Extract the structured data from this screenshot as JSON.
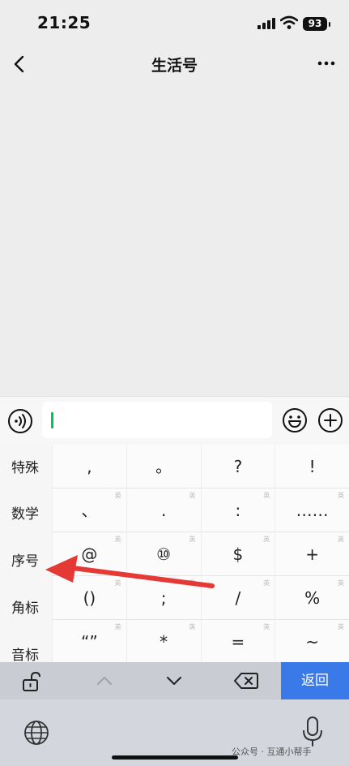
{
  "status_bar": {
    "time": "21:25",
    "battery": "93"
  },
  "nav": {
    "title": "生活号"
  },
  "keyboard": {
    "categories": [
      "特殊",
      "数学",
      "序号",
      "角标",
      "音标"
    ],
    "symbols": [
      [
        ",",
        "。",
        "?",
        "!"
      ],
      [
        "、",
        ".",
        ":",
        "……"
      ],
      [
        "@",
        "⑩",
        "$",
        "+"
      ],
      [
        "()",
        ";",
        "/",
        "%"
      ],
      [
        "“”",
        "*",
        "=",
        "~"
      ]
    ],
    "return_label": "返回"
  },
  "watermark": "公众号 · 互通小帮手",
  "annotation": {
    "color": "#e53935"
  },
  "colors": {
    "accent": "#07c160",
    "return_button": "#3a7ae8"
  }
}
